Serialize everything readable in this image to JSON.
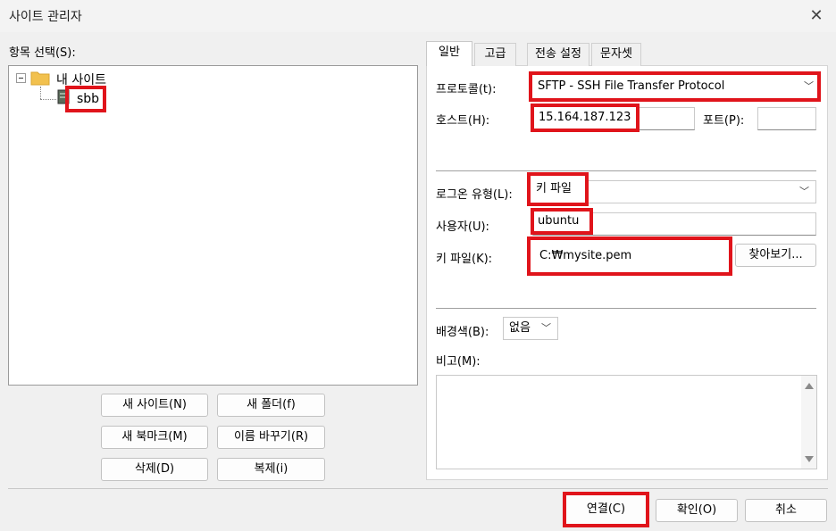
{
  "window": {
    "title": "사이트 관리자",
    "close": "✕"
  },
  "left": {
    "select_label": "항목 선택(S):",
    "tree": {
      "root": "내 사이트",
      "expander": "⊟",
      "child": "sbb"
    },
    "buttons": {
      "new_site": "새 사이트(N)",
      "new_folder": "새 폴더(f)",
      "new_bookmark": "새 북마크(M)",
      "rename": "이름 바꾸기(R)",
      "delete": "삭제(D)",
      "duplicate": "복제(i)"
    }
  },
  "tabs": [
    "일반",
    "고급",
    "전송 설정",
    "문자셋"
  ],
  "general": {
    "protocol_label": "프로토콜(t):",
    "protocol_value": "SFTP - SSH File Transfer Protocol",
    "host_label": "호스트(H):",
    "host_value": "15.164.187.123",
    "port_label": "포트(P):",
    "port_value": "",
    "logon_label": "로그온 유형(L):",
    "logon_value": "키 파일",
    "user_label": "사용자(U):",
    "user_value": "ubuntu",
    "keyfile_label": "키 파일(K):",
    "keyfile_value": "C:₩mysite.pem",
    "browse": "찾아보기...",
    "bgcolor_label": "배경색(B):",
    "bgcolor_value": "없음",
    "comments_label": "비고(M):"
  },
  "footer": {
    "connect": "연결(C)",
    "ok": "확인(O)",
    "cancel": "취소"
  },
  "colors": {
    "highlight": "#e0141b",
    "folder": "#f2c14e"
  }
}
